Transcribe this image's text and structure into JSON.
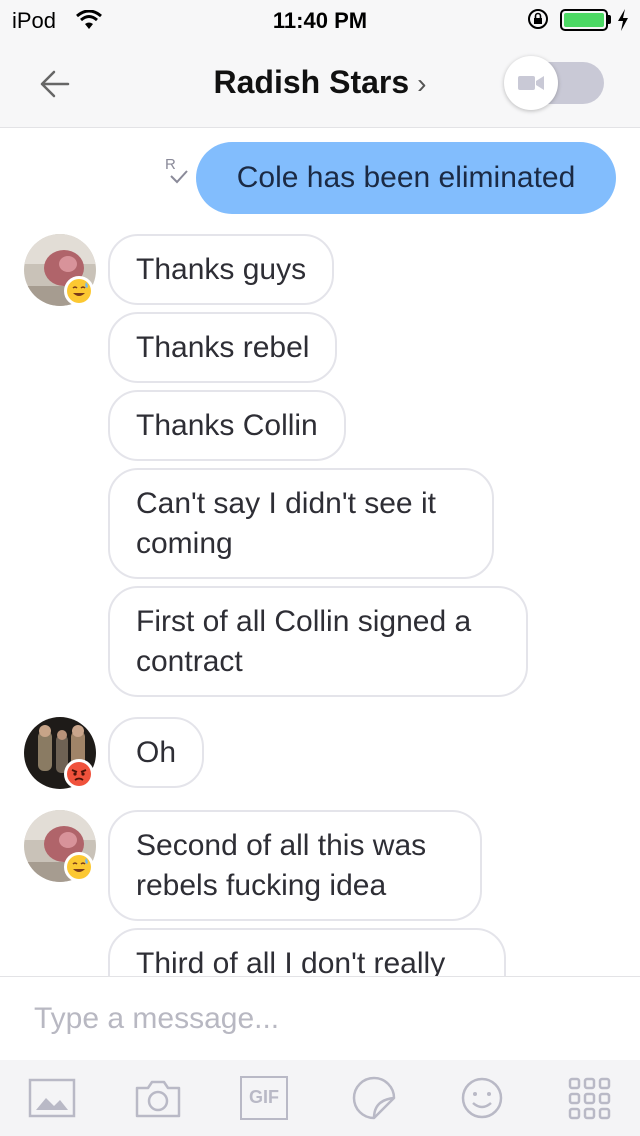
{
  "status_bar": {
    "carrier": "iPod",
    "time": "11:40 PM"
  },
  "header": {
    "title": "Radish Stars",
    "chevron": "›"
  },
  "messages": {
    "outgoing": {
      "text": "Cole has been eliminated",
      "receipt": "R"
    },
    "incoming": [
      {
        "text": "Thanks guys"
      },
      {
        "text": "Thanks rebel"
      },
      {
        "text": "Thanks Collin"
      },
      {
        "text": "Can't say I didn't see it coming"
      },
      {
        "text": "First of all Collin signed a contract"
      },
      {
        "text": "Oh"
      },
      {
        "text": "Second of all this was rebels fucking idea"
      },
      {
        "text": "Third of all I don't really"
      }
    ]
  },
  "composer": {
    "placeholder": "Type a message..."
  },
  "toolbar": {
    "gif_label": "GIF"
  },
  "colors": {
    "outgoing_bubble": "#82bdfd",
    "battery": "#4cd964",
    "toggle": "#c9c9d6"
  }
}
